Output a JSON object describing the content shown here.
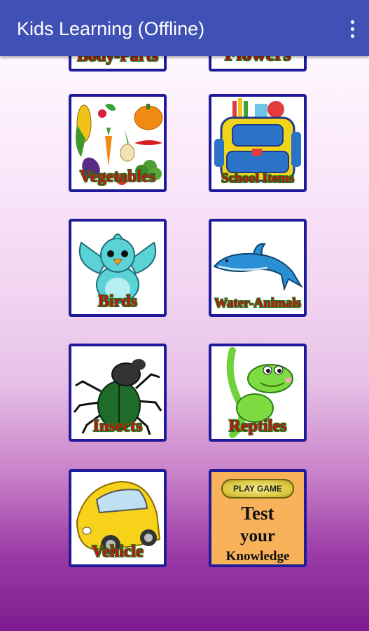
{
  "appbar": {
    "title": "Kids Learning (Offline)",
    "menu_icon": "overflow-menu-icon"
  },
  "tiles": {
    "body_parts": "Body-Parts",
    "flowers": "Flowers",
    "vegetables": "Vegetables",
    "school_items": "School Items",
    "birds": "Birds",
    "water_animals": "Water-Animals",
    "insects": "Insects",
    "reptiles": "Reptiles",
    "vehicle": "Vehicle"
  },
  "test_tile": {
    "play_label": "PLAY GAME",
    "line1": "Test",
    "line2": "your",
    "line3": "Knowledge"
  }
}
